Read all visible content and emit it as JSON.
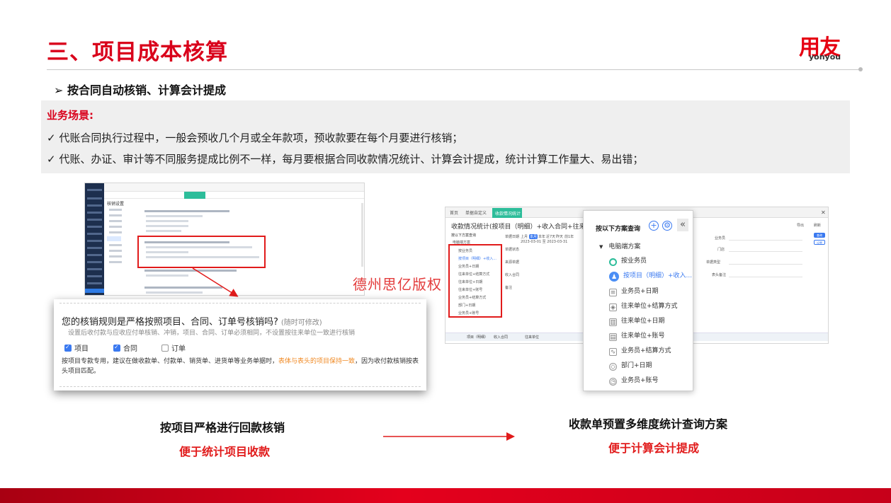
{
  "header": {
    "title": "三、项目成本核算",
    "sub_title": "➢  按合同自动核销、计算会计提成",
    "logo_cn": "用友",
    "logo_en": "yonyou"
  },
  "scenario": {
    "heading": "业务场景:",
    "lines": [
      "✓ 代账合同执行过程中，一般会预收几个月或全年款项，预收款要在每个月要进行核销；",
      "✓ 代账、办证、审计等不同服务提成比例不一样，每月要根据合同收款情况统计、计算会计提成，统计计算工作量大、易出错；"
    ]
  },
  "left_screenshot": {
    "pane_title": "核销设置"
  },
  "zoom_card": {
    "question": "您的核销规则是严格按照项目、合同、订单号核销吗?",
    "question_note": "(随时可修改)",
    "tip": "设置后收付款与应收应付单核销、冲销，项目、合同、订单必须相同，不设置按往来单位一致进行核销",
    "options": [
      {
        "label": "项目",
        "checked": true
      },
      {
        "label": "合同",
        "checked": true
      },
      {
        "label": "订单",
        "checked": false
      }
    ],
    "desc_before": "按项目专款专用，建议在做收款单、付款单、销货单、进货单等业务单据时，",
    "desc_highlight": "表体与表头的项目保持一致",
    "desc_after": "，因为收付款核销按表头项目匹配。"
  },
  "watermark": "德州思亿版权",
  "right_screenshot": {
    "tabs": [
      "首页",
      "单据自定义",
      "收款情况统计"
    ],
    "title": "收款情况统计(按项目（明细）+收入合同+往来单位+业务员",
    "pane_head": "按以下方案查询",
    "items": [
      "电脑端方案",
      "按业务员",
      "按项目（明细）+收入...",
      "业务员+日期",
      "往来单位+结算方式",
      "往来单位+日期",
      "往来单位+账号",
      "业务员+结算方式",
      "部门+日期",
      "业务员+账号"
    ],
    "fields": [
      "单据日期",
      "单据状态",
      "来源单据",
      "收入合同",
      "备注",
      "业务员",
      "门店",
      "单据类型",
      "表头备注"
    ],
    "date_chips": [
      "上月",
      "本月",
      "本年",
      "近7天",
      "昨天",
      "前1年"
    ],
    "date_range": "2023-03-01 至 2023-03-31",
    "table_headers": [
      "项目（明细）",
      "收入合同",
      "往来单位"
    ],
    "buttons": [
      "查询",
      "设置",
      "导出",
      "刷新"
    ]
  },
  "popup": {
    "title": "按以下方案查询",
    "group": "电脑端方案",
    "items": [
      {
        "label": "按业务员",
        "icon": "person-icon"
      },
      {
        "label": "按项目（明细）+收入...",
        "icon": "chart-icon"
      },
      {
        "label": "业务员+日期",
        "icon": "table-icon"
      },
      {
        "label": "往来单位+结算方式",
        "icon": "settlement-icon"
      },
      {
        "label": "往来单位+日期",
        "icon": "bar-chart-icon"
      },
      {
        "label": "往来单位+账号",
        "icon": "table-icon"
      },
      {
        "label": "业务员+结算方式",
        "icon": "line-chart-icon"
      },
      {
        "label": "部门+日期",
        "icon": "cube-icon"
      },
      {
        "label": "业务员+账号",
        "icon": "clock-icon"
      }
    ]
  },
  "captions": {
    "left_main": "按项目严格进行回款核销",
    "left_sub": "便于统计项目收款",
    "right_main": "收款单预置多维度统计查询方案",
    "right_sub": "便于计算会计提成"
  },
  "colors": {
    "brand_red": "#d9001b",
    "accent_teal": "#2dbd9a",
    "accent_blue": "#3a79f0",
    "highlight_orange": "#f08a24"
  }
}
